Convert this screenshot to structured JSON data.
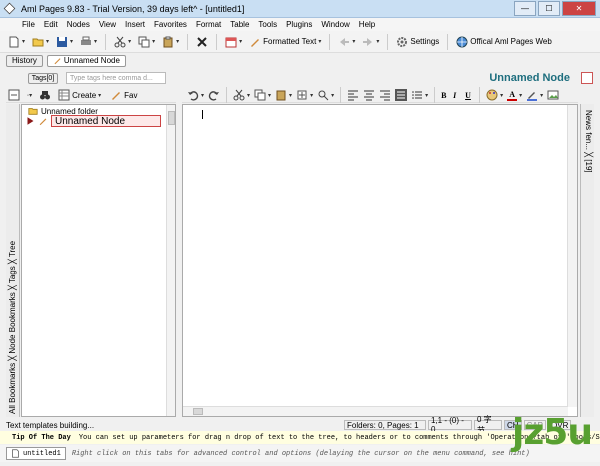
{
  "window": {
    "title": "Aml Pages 9.83 - Trial Version, 39 days left^ - [untitled1]",
    "min": "—",
    "max": "☐",
    "close": "✕"
  },
  "menu": [
    "File",
    "Edit",
    "Nodes",
    "View",
    "Insert",
    "Favorites",
    "Format",
    "Table",
    "Tools",
    "Plugins",
    "Window",
    "Help"
  ],
  "toolbar": {
    "template_label": "Formatted Text",
    "settings_label": "Settings",
    "web_label": "Offical Aml Pages Web"
  },
  "nav": {
    "history_label": "History",
    "tab_label": "Unnamed Node"
  },
  "tags": {
    "button_label": "Tags[0]",
    "placeholder": "Type tags here comma d...",
    "node_title": "Unnamed Node"
  },
  "tree_toolbar": {
    "create_label": "Create",
    "fav_label": "Fav"
  },
  "tree": {
    "folder_label": "Unnamed folder",
    "node_label": "Unnamed Node"
  },
  "left_tabs": {
    "label": "All Bookmarks ╳ Node Bookmarks ╳ Tags ╳ Tree"
  },
  "right_tabs": {
    "label": "News fen... ╳ [19]"
  },
  "editor_toolbar": {
    "bold": "B",
    "italic": "I",
    "underline": "U",
    "font_color": "A"
  },
  "status": {
    "message": "Text templates building...",
    "folders": "Folders: 0, Pages: 1",
    "position": "1,1 - (0) - 0",
    "chars": "0 字节",
    "ch": "CH",
    "cap": "CAP",
    "ovr": "OVR"
  },
  "tip": {
    "title": "Tip Of The Day",
    "text": "You can set up parameters for drag n drop of text to the tree, to headers or to comments through 'Operations?tab of 'Tools/Se..."
  },
  "doc": {
    "tab_label": "untitled1",
    "hint": "Right click on this tabs for advanced control and options (delaying the cursor on the menu command, see hint)"
  },
  "watermark": {
    "text": "jz5u"
  },
  "colors": {
    "accent": "#1e6e7e",
    "selected_border": "#cc4444",
    "watermark": "#58a030"
  }
}
